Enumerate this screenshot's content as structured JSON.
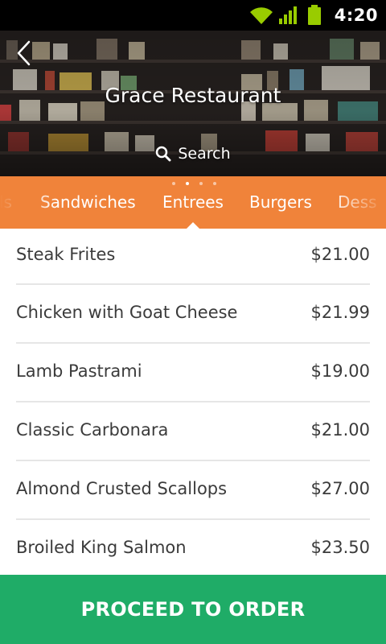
{
  "status_bar": {
    "time": "4:20",
    "icons": [
      "wifi-icon",
      "signal-icon",
      "battery-icon"
    ]
  },
  "header": {
    "title": "Grace Restaurant",
    "search_label": "Search",
    "back_icon": "chevron-left-icon",
    "search_icon": "search-icon"
  },
  "tabs": {
    "items": [
      {
        "label": "Salads",
        "visible_text": "ls"
      },
      {
        "label": "Sandwiches"
      },
      {
        "label": "Entrees",
        "active": true
      },
      {
        "label": "Burgers"
      },
      {
        "label": "Desserts",
        "visible_text": "Dess"
      }
    ],
    "pager_dots": 4,
    "pager_active_index": 1
  },
  "menu": {
    "items": [
      {
        "name": "Steak Frites",
        "price": "$21.00"
      },
      {
        "name": "Chicken with Goat Cheese",
        "price": "$21.99"
      },
      {
        "name": "Lamb Pastrami",
        "price": "$19.00"
      },
      {
        "name": "Classic Carbonara",
        "price": "$21.00"
      },
      {
        "name": "Almond Crusted Scallops",
        "price": "$27.00"
      },
      {
        "name": "Broiled King Salmon",
        "price": "$23.50"
      }
    ]
  },
  "order_button": {
    "label": "PROCEED TO ORDER"
  },
  "colors": {
    "status_bar": "#000000",
    "tab_bar": "#f0833a",
    "order_button": "#1fac67",
    "text": "#3b3b3b",
    "divider": "#e6e6e6",
    "status_icons": "#99cc00"
  }
}
